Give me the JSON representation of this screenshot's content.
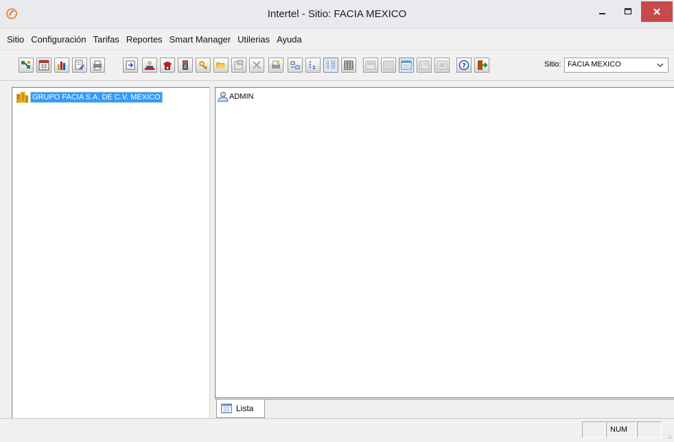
{
  "window": {
    "title": "Intertel - Sitio: FACIA MEXICO",
    "close_color": "#c74a4a"
  },
  "menu": {
    "items": [
      "Sitio",
      "Configuración",
      "Tarifas",
      "Reportes",
      "Smart Manager",
      "Utilerias",
      "Ayuda"
    ]
  },
  "toolbar": {
    "buttons": [
      "network-config-icon",
      "calendar-grid-icon",
      "bar-chart-icon",
      "edit-report-icon",
      "printer-icon",
      "import-icon",
      "users-icon",
      "phone-book-icon",
      "device-icon",
      "key-icon",
      "open-folder-icon",
      "properties-icon",
      "delete-icon",
      "print-preview-icon",
      "large-icons-view-icon",
      "small-icons-view-icon",
      "list-view-icon",
      "details-view-icon",
      "view-a-icon",
      "view-b-icon",
      "view-lista-icon",
      "view-c-icon",
      "view-d-icon",
      "help-icon",
      "exit-icon"
    ],
    "site_label": "Sitio:",
    "site_value": "FACIA MEXICO"
  },
  "tree": {
    "root_label": "GRUPO FACIA S.A. DE C.V. MEXICO",
    "selection_color": "#3399ff"
  },
  "list": {
    "items": [
      "ADMIN"
    ]
  },
  "tabs": {
    "active_label": "Lista"
  },
  "status": {
    "num_label": "NUM"
  }
}
